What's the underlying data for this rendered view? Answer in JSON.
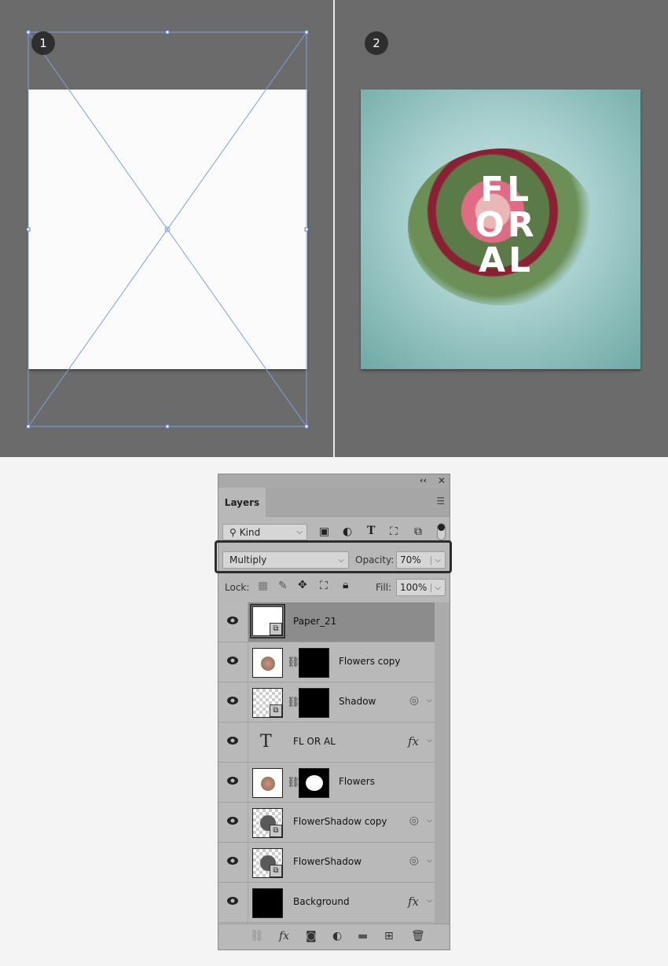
{
  "canvas": {
    "step1_label": "1",
    "step2_label": "2",
    "artwork_text": [
      "FL",
      "OR",
      "AL"
    ]
  },
  "layers_panel": {
    "collapse_icon": "double-chevron-left-icon",
    "close_icon": "close-icon",
    "tab_label": "Layers",
    "menu_icon": "hamburger-icon",
    "filter": {
      "value": "Kind",
      "icons": [
        "image-filter-icon",
        "adjustment-filter-icon",
        "type-filter-icon",
        "shape-filter-icon",
        "smart-object-filter-icon",
        "filter-toggle"
      ]
    },
    "blend_mode": "Multiply",
    "opacity_label": "Opacity:",
    "opacity_value": "70%",
    "lock_label": "Lock:",
    "lock_icons": [
      "lock-transparent-icon",
      "lock-pixels-icon",
      "lock-position-icon",
      "lock-artboard-icon",
      "lock-all-icon"
    ],
    "fill_label": "Fill:",
    "fill_value": "100%",
    "layers": [
      {
        "name": "Paper_21",
        "selected": true,
        "type": "smart"
      },
      {
        "name": "Flowers copy",
        "type": "masked"
      },
      {
        "name": "Shadow",
        "type": "masked-smart",
        "badge": "blend-if"
      },
      {
        "name": "FL OR AL",
        "type": "text",
        "badge": "fx"
      },
      {
        "name": "Flowers",
        "type": "masked"
      },
      {
        "name": "FlowerShadow copy",
        "type": "smart",
        "badge": "blend-if"
      },
      {
        "name": "FlowerShadow",
        "type": "smart",
        "badge": "blend-if"
      },
      {
        "name": "Background",
        "type": "fill",
        "badge": "fx"
      }
    ],
    "fx_label": "fx",
    "footer_icons": [
      "link-layers-icon",
      "fx-icon",
      "mask-icon",
      "adjustment-layer-icon",
      "group-folder-icon",
      "new-layer-icon",
      "trash-icon"
    ]
  }
}
